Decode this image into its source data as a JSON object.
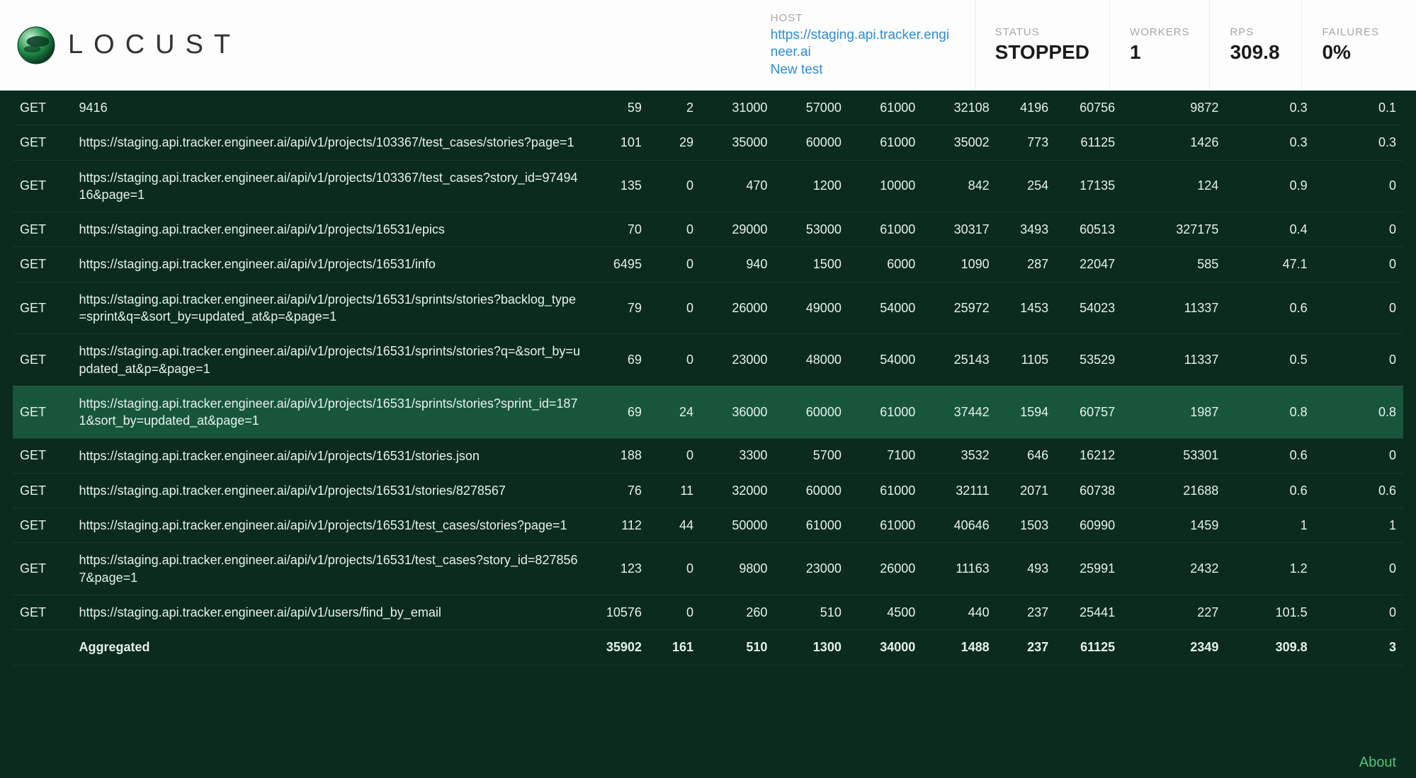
{
  "brand": {
    "name": "LOCUST"
  },
  "header": {
    "host": {
      "label": "HOST",
      "value": "https://staging.api.tracker.engineer.ai",
      "new_test": "New test"
    },
    "status": {
      "label": "STATUS",
      "value": "STOPPED"
    },
    "workers": {
      "label": "WORKERS",
      "value": "1"
    },
    "rps": {
      "label": "RPS",
      "value": "309.8"
    },
    "failures": {
      "label": "FAILURES",
      "value": "0%"
    }
  },
  "rows": [
    {
      "method": "GET",
      "name": "9416",
      "reqs": "59",
      "fails": "2",
      "median": "31000",
      "p90": "57000",
      "p99": "61000",
      "avg": "32108",
      "min": "4196",
      "max": "60756",
      "size": "9872",
      "rps": "0.3",
      "fps": "0.1",
      "partial": true
    },
    {
      "method": "GET",
      "name": "https://staging.api.tracker.engineer.ai/api/v1/projects/103367/test_cases/stories?page=1",
      "reqs": "101",
      "fails": "29",
      "median": "35000",
      "p90": "60000",
      "p99": "61000",
      "avg": "35002",
      "min": "773",
      "max": "61125",
      "size": "1426",
      "rps": "0.3",
      "fps": "0.3"
    },
    {
      "method": "GET",
      "name": "https://staging.api.tracker.engineer.ai/api/v1/projects/103367/test_cases?story_id=9749416&page=1",
      "reqs": "135",
      "fails": "0",
      "median": "470",
      "p90": "1200",
      "p99": "10000",
      "avg": "842",
      "min": "254",
      "max": "17135",
      "size": "124",
      "rps": "0.9",
      "fps": "0"
    },
    {
      "method": "GET",
      "name": "https://staging.api.tracker.engineer.ai/api/v1/projects/16531/epics",
      "reqs": "70",
      "fails": "0",
      "median": "29000",
      "p90": "53000",
      "p99": "61000",
      "avg": "30317",
      "min": "3493",
      "max": "60513",
      "size": "327175",
      "rps": "0.4",
      "fps": "0"
    },
    {
      "method": "GET",
      "name": "https://staging.api.tracker.engineer.ai/api/v1/projects/16531/info",
      "reqs": "6495",
      "fails": "0",
      "median": "940",
      "p90": "1500",
      "p99": "6000",
      "avg": "1090",
      "min": "287",
      "max": "22047",
      "size": "585",
      "rps": "47.1",
      "fps": "0"
    },
    {
      "method": "GET",
      "name": "https://staging.api.tracker.engineer.ai/api/v1/projects/16531/sprints/stories?backlog_type=sprint&q=&sort_by=updated_at&p=&page=1",
      "reqs": "79",
      "fails": "0",
      "median": "26000",
      "p90": "49000",
      "p99": "54000",
      "avg": "25972",
      "min": "1453",
      "max": "54023",
      "size": "11337",
      "rps": "0.6",
      "fps": "0"
    },
    {
      "method": "GET",
      "name": "https://staging.api.tracker.engineer.ai/api/v1/projects/16531/sprints/stories?q=&sort_by=updated_at&p=&page=1",
      "reqs": "69",
      "fails": "0",
      "median": "23000",
      "p90": "48000",
      "p99": "54000",
      "avg": "25143",
      "min": "1105",
      "max": "53529",
      "size": "11337",
      "rps": "0.5",
      "fps": "0"
    },
    {
      "method": "GET",
      "name": "https://staging.api.tracker.engineer.ai/api/v1/projects/16531/sprints/stories?sprint_id=1871&sort_by=updated_at&page=1",
      "reqs": "69",
      "fails": "24",
      "median": "36000",
      "p90": "60000",
      "p99": "61000",
      "avg": "37442",
      "min": "1594",
      "max": "60757",
      "size": "1987",
      "rps": "0.8",
      "fps": "0.8",
      "highlight": true
    },
    {
      "method": "GET",
      "name": "https://staging.api.tracker.engineer.ai/api/v1/projects/16531/stories.json",
      "reqs": "188",
      "fails": "0",
      "median": "3300",
      "p90": "5700",
      "p99": "7100",
      "avg": "3532",
      "min": "646",
      "max": "16212",
      "size": "53301",
      "rps": "0.6",
      "fps": "0"
    },
    {
      "method": "GET",
      "name": "https://staging.api.tracker.engineer.ai/api/v1/projects/16531/stories/8278567",
      "reqs": "76",
      "fails": "11",
      "median": "32000",
      "p90": "60000",
      "p99": "61000",
      "avg": "32111",
      "min": "2071",
      "max": "60738",
      "size": "21688",
      "rps": "0.6",
      "fps": "0.6"
    },
    {
      "method": "GET",
      "name": "https://staging.api.tracker.engineer.ai/api/v1/projects/16531/test_cases/stories?page=1",
      "reqs": "112",
      "fails": "44",
      "median": "50000",
      "p90": "61000",
      "p99": "61000",
      "avg": "40646",
      "min": "1503",
      "max": "60990",
      "size": "1459",
      "rps": "1",
      "fps": "1"
    },
    {
      "method": "GET",
      "name": "https://staging.api.tracker.engineer.ai/api/v1/projects/16531/test_cases?story_id=8278567&page=1",
      "reqs": "123",
      "fails": "0",
      "median": "9800",
      "p90": "23000",
      "p99": "26000",
      "avg": "11163",
      "min": "493",
      "max": "25991",
      "size": "2432",
      "rps": "1.2",
      "fps": "0"
    },
    {
      "method": "GET",
      "name": "https://staging.api.tracker.engineer.ai/api/v1/users/find_by_email",
      "reqs": "10576",
      "fails": "0",
      "median": "260",
      "p90": "510",
      "p99": "4500",
      "avg": "440",
      "min": "237",
      "max": "25441",
      "size": "227",
      "rps": "101.5",
      "fps": "0"
    }
  ],
  "aggregated": {
    "label": "Aggregated",
    "reqs": "35902",
    "fails": "161",
    "median": "510",
    "p90": "1300",
    "p99": "34000",
    "avg": "1488",
    "min": "237",
    "max": "61125",
    "size": "2349",
    "rps": "309.8",
    "fps": "3"
  },
  "footer": {
    "about": "About"
  }
}
